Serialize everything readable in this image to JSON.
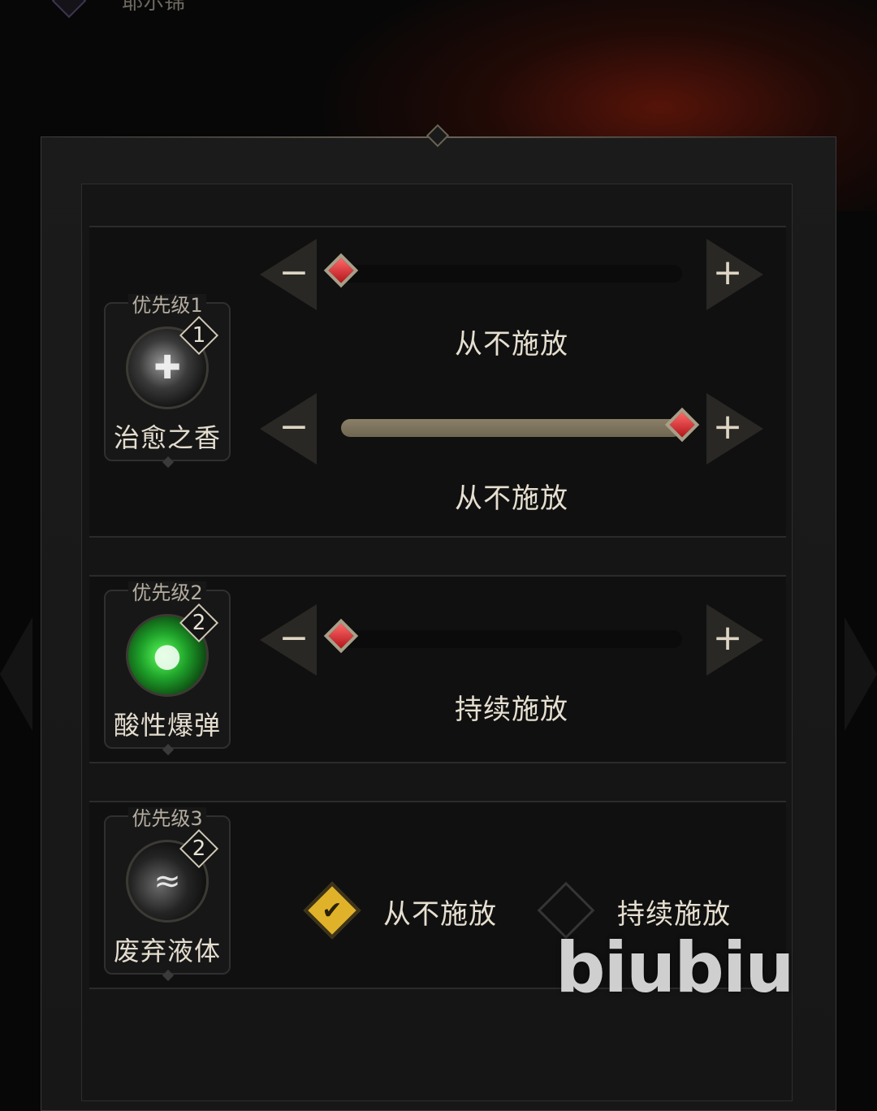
{
  "header": {
    "title": "耶尔锦"
  },
  "rows": [
    {
      "priority_label": "优先级1",
      "skill_name": "治愈之香",
      "badge": "1",
      "icon": "healing-incense-icon",
      "sliders": [
        {
          "level": 0.0,
          "status": "从不施放"
        },
        {
          "level": 1.0,
          "status": "从不施放"
        }
      ]
    },
    {
      "priority_label": "优先级2",
      "skill_name": "酸性爆弹",
      "badge": "2",
      "icon": "acid-bomb-icon",
      "sliders": [
        {
          "level": 0.0,
          "status": "持续施放"
        }
      ]
    },
    {
      "priority_label": "优先级3",
      "skill_name": "废弃液体",
      "badge": "2",
      "icon": "waste-liquid-icon",
      "options": [
        {
          "label": "从不施放",
          "checked": true
        },
        {
          "label": "持续施放",
          "checked": false
        }
      ]
    }
  ],
  "controls": {
    "minus": "−",
    "plus": "+"
  },
  "watermark": "biubiu",
  "colors": {
    "accent_gold": "#e0b22a",
    "thumb_red": "#c8181f",
    "fill": "#8b8068"
  }
}
